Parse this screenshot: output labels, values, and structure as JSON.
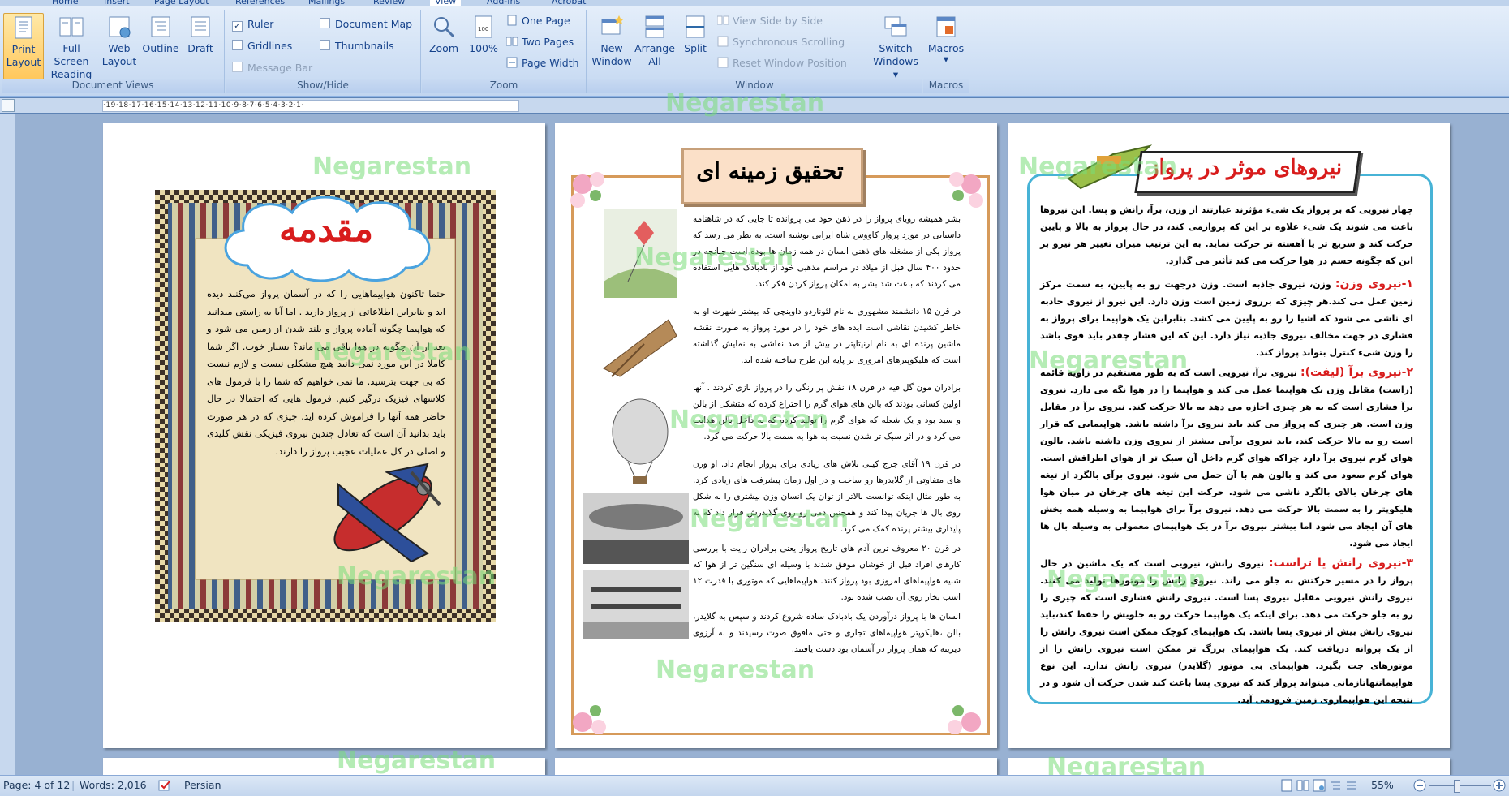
{
  "ribbon_tabs": [
    "Home",
    "Insert",
    "Page Layout",
    "References",
    "Mailings",
    "Review",
    "View",
    "Add-Ins",
    "Acrobat"
  ],
  "ribbon": {
    "document_views": {
      "label": "Document Views",
      "print_layout": "Print Layout",
      "full_screen": "Full Screen Reading",
      "web_layout": "Web Layout",
      "outline": "Outline",
      "draft": "Draft"
    },
    "show_hide": {
      "label": "Show/Hide",
      "ruler": "Ruler",
      "gridlines": "Gridlines",
      "message_bar": "Message Bar",
      "document_map": "Document Map",
      "thumbnails": "Thumbnails"
    },
    "zoom": {
      "label": "Zoom",
      "zoom": "Zoom",
      "hundred": "100%",
      "one_page": "One Page",
      "two_pages": "Two Pages",
      "page_width": "Page Width"
    },
    "window": {
      "label": "Window",
      "new_window": "New Window",
      "arrange_all": "Arrange All",
      "split": "Split",
      "view_side": "View Side by Side",
      "sync_scroll": "Synchronous Scrolling",
      "reset_pos": "Reset Window Position",
      "switch_windows": "Switch Windows"
    },
    "macros": {
      "label": "Macros",
      "macros": "Macros"
    }
  },
  "ruler_text": "·19·18·17·16·15·14·13·12·11·10·9·8·7·6·5·4·3·2·1·",
  "watermark": "Negarestan",
  "page1": {
    "title": "مقدمه",
    "body": "حتما تاکنون هواپیماهایی را که در آسمان پرواز می‌کنند دیده اید و بنابراین اطلاعاتی از پرواز دارید . اما آیا به راستی میدانید که هواپیما چگونه آماده پرواز و بلند شدن از زمین می شود و بعد از آن چگونه در هوا باقی می ماند؟ بسیار خوب. اگر شما کاملا در این مورد نمی دانید هیچ مشکلی نیست و لازم نیست که بی جهت بترسید. ما نمی خواهیم که شما را با فرمول های کلاسهای فیزیک درگیر کنیم. فرمول هایی که احتمالا در حال حاضر همه آنها را فراموش کرده اید. چیزی که در هر صورت باید بدانید آن است که تعادل چندین نیروی فیزیکی نقش کلیدی و اصلی در کل عملیات عجیب پرواز را دارند."
  },
  "page2": {
    "title": "تحقیق زمینه ای",
    "paragraphs": [
      "بشر همیشه رویای پرواز را در ذهن خود می پروانده تا جایی که در شاهنامه داستانی در مورد پرواز کاووس شاه ایرانی نوشته است. به نظر می رسد که پرواز یکی از مشغله های ذهنی انسان در همه زمان ها بوده است چنانچه در حدود ۴۰۰ سال قبل از میلاد در مراسم مذهبی خود از بادبادک هایی استفاده می کردند که باعث شد بشر به امکان پرواز کردن فکر کند.",
      "در قرن ۱۵ دانشمند مشهوری به نام لئوناردو داوینچی که بیشتر شهرت او به خاطر کشیدن نقاشی است ایده های خود را در مورد پرواز به صورت نقشه ماشین پرنده ای به نام ارنیتاپتر در بیش از صد نقاشی به نمایش گذاشته است که هلیکوپترهای امروزی بر پایه این طرح ساخته شده اند.",
      "برادران مون گل فیه در قرن ۱۸ نقش پر رنگی را در پرواز بازی کردند . آنها اولین کسانی بودند که بالن های هوای گرم را اختراع کرده که متشکل از بالن و سبد بود و یک شعله که هوای گرم را تولید کرده که به داخل بالن هدایت می کرد و در اثر سبک تر شدن نسبت به هوا به سمت بالا حرکت می کرد.",
      "در قرن ۱۹ آقای جرج کیلی تلاش های زیادی برای پرواز انجام داد. او وزن های متفاوتی از گلایدرها رو ساخت و در اول زمان پیشرفت های زیادی کرد. به طور مثال اینکه توانست بالاتر از توان یک انسان وزن بیشتری را به شکل روی بال ها جریان پیدا کند و همچنین دمی رو روی گلایدرش قرار داد که به پایداری بیشتر پرنده کمک می کرد.",
      "در قرن ۲۰ معروف ترین آدم های تاریخ پرواز یعنی برادران رایت با بررسی کارهای افراد قبل از خوشان موفق شدند با وسیله ای سنگین تر از هوا که شبیه هواپیماهای امروزی بود پرواز کنند. هواپیماهایی که موتوری با قدرت ۱۲ اسب بخار روی آن نصب شده بود.",
      "انسان ها با پرواز درآوردن یک بادبادک ساده شروع کردند و سپس به گلایدر، بالن ،هلیکوپتر هواپیماهای تجاری و حتی مافوق صوت رسیدند و به آرزوی دیرینه که همان پرواز در آسمان بود دست یافتند."
    ]
  },
  "page3": {
    "title": "نیروهای موثر در پرواز",
    "intro": "چهار نیرویی که بر پرواز یک شیء مؤثرند عبارتند از وزن، برآ، رانش و پسا. این نیروها باعث می شوند یک شیء علاوه بر این که پروازمی کند، در حال پرواز به بالا و پایین حرکت کند و سریع تر یا آهسته تر حرکت نماید. به این ترتیب میزان تغییر هر نیرو بر این که چگونه جسم در هوا حرکت می کند تأثیر می گذارد.",
    "sections": [
      {
        "head": "۱-نیروی وزن:",
        "text": "وزن، نیروی جاذبه است. وزن درجهت رو به پایین، به سمت مرکز زمین عمل می کند.هر چیزی که برروی زمین است وزن دارد. این نیرو از نیروی جاذبه ای ناشی می شود که اشیا را رو به پایین می کشد. بنابراین یک هواپیما برای پرواز به فشاری در جهت مخالف نیروی جاذبه نیاز دارد. این که این فشار چقدر باید قوی باشد را وزن شیء کنترل بتواند پرواز کند."
      },
      {
        "head": "۲-نیروی برآ (لیفت):",
        "text": "نیروی برآ، نیرویی است که به طور مستقیم در زاویه قائمه (راست) مقابل وزن یک هواپیما عمل می کند و هواپیما را در هوا نگه می دارد. نیروی برآ فشاری است که به هر چیزی اجازه می دهد به بالا حرکت کند. نیروی برآ در مقابل وزن است. هر چیزی که پرواز می کند باید نیروی برآ داشته باشد. هواپیمایی که قرار است رو به بالا حرکت کند، باید نیروی برآیی بیشتر از نیروی وزن داشته باشد. بالون هوای گرم نیروی برآ دارد چراکه هوای گرم داخل آن سبک تر از هوای اطرافش است. هوای گرم صعود می کند و بالون هم با آن حمل می شود. نیروی برآی بالگرد از تیغه های چرخان بالای بالگرد ناشی می شود. حرکت این تیغه های چرخان در میان هوا هلیکوپتر را به سمت بالا حرکت می دهد. نیروی برآ برای هواپیما به وسیله همه بخش های آن ایجاد می شود اما بیشتر نیروی برآ در یک هواپیمای معمولی به وسیله بال ها ایجاد می شود."
      },
      {
        "head": "۳-نیروی رانش یا تراست:",
        "text": "نیروی رانش، نیرویی است که یک ماشین در حال پرواز را در مسیر حرکتش به جلو می راند. نیروی رانش را موتورها تولید می کنند. نیروی رانش نیرویی مقابل نیروی پسا است. نیروی رانش فشاری است که چیزی را رو به جلو حرکت می دهد. برای اینکه یک هواپیما حرکت رو به جلویش را حفظ کند،باید نیروی رانش بیش از نیروی پسا باشد. یک هواپیمای کوچک ممکن است نیروی رانش را از یک پروانه دریافت کند. یک هواپیمای بزرگ تر ممکن است نیروی رانش را از موتورهای جت بگیرد. هواپیمای بی موتور (گلایدر) نیروی رانش ندارد. این نوع هواپیماتنهاتازمانی میتواند پرواز کند که نیروی پسا باعث کند شدن حرکت آن شود و در نتیجه این هواپیماروی زمین فرودمی آید."
      }
    ]
  },
  "status": {
    "page": "Page: 4 of 12",
    "words": "Words: 2,016",
    "language": "Persian",
    "zoom": "55%"
  }
}
